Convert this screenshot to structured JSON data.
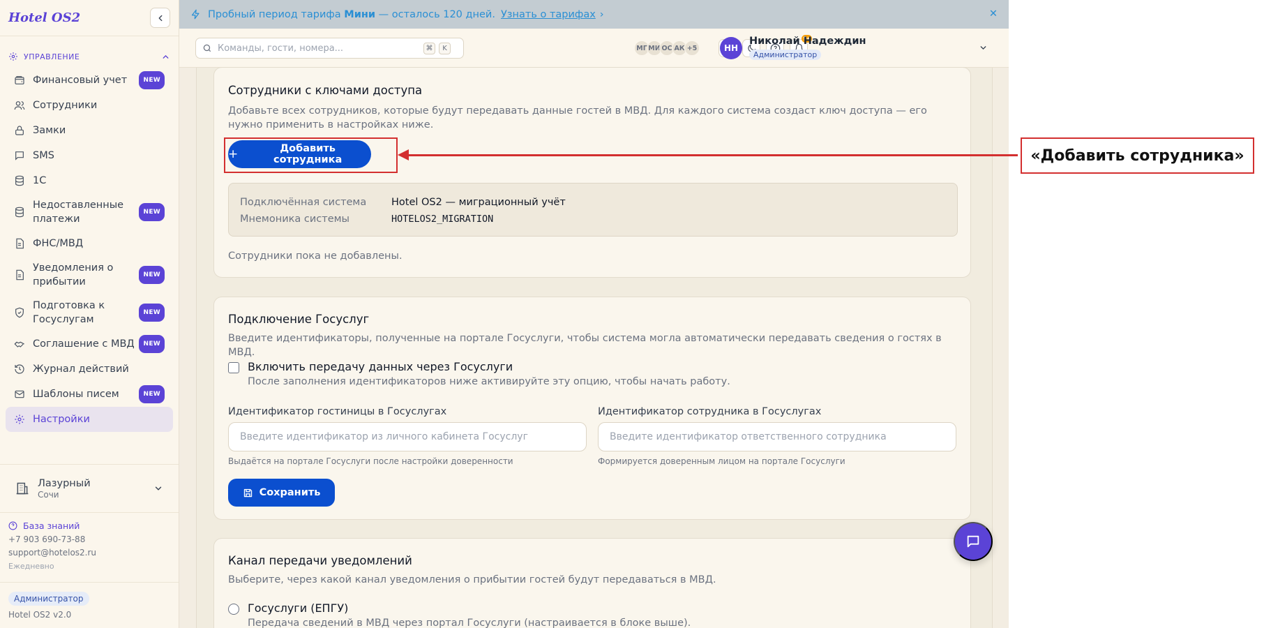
{
  "app": {
    "logo": "Hotel OS2",
    "version": "Hotel OS2 v2.0"
  },
  "colors": {
    "brand": "#5b43d6",
    "primary_button": "#0b4fcf",
    "callout": "#d32f2f",
    "notification_badge": "#f59e0b"
  },
  "sidebar": {
    "section_title": "УПРАВЛЕНИЕ",
    "items": [
      {
        "label": "Финансовый учет",
        "badge": "NEW",
        "icon": "wallet-icon"
      },
      {
        "label": "Сотрудники",
        "badge": "",
        "icon": "users-icon"
      },
      {
        "label": "Замки",
        "badge": "",
        "icon": "lock-icon"
      },
      {
        "label": "SMS",
        "badge": "",
        "icon": "message-icon"
      },
      {
        "label": "1С",
        "badge": "",
        "icon": "database-icon"
      },
      {
        "label": "Недоставленные платежи",
        "badge": "NEW",
        "icon": "database-icon"
      },
      {
        "label": "ФНС/МВД",
        "badge": "",
        "icon": "document-icon"
      },
      {
        "label": "Уведомления о прибытии",
        "badge": "NEW",
        "icon": "document-icon"
      },
      {
        "label": "Подготовка к Госуслугам",
        "badge": "NEW",
        "icon": "shield-check-icon"
      },
      {
        "label": "Соглашение с МВД",
        "badge": "NEW",
        "icon": "handshake-icon"
      },
      {
        "label": "Журнал действий",
        "badge": "",
        "icon": "history-icon"
      },
      {
        "label": "Шаблоны писем",
        "badge": "NEW",
        "icon": "mail-icon"
      },
      {
        "label": "Настройки",
        "badge": "",
        "icon": "gear-icon",
        "active": true
      }
    ],
    "hotel": {
      "name": "Лазурный",
      "city": "Сочи"
    },
    "help": {
      "knowledge_base": "База знаний",
      "phone": "+7 903 690-73-88",
      "email": "support@hotelos2.ru",
      "schedule": "Ежедневно"
    },
    "role": "Администратор"
  },
  "trial_banner": {
    "text_before": "Пробный период тарифа",
    "plan": "Мини",
    "text_after": "— осталось 120 дней.",
    "link": "Узнать о тарифах",
    "arrow": "›",
    "close": "✕"
  },
  "topbar": {
    "search_placeholder": "Команды, гости, номера...",
    "shortcut_keys": [
      "⌘",
      "K"
    ],
    "avatars": [
      "МГ",
      "МИ",
      "ОС",
      "АК",
      "+5"
    ],
    "notifications_count": "9+",
    "user": {
      "initials": "НН",
      "name": "Николай Надеждин",
      "role": "Администратор"
    }
  },
  "staff_card": {
    "title": "Сотрудники с ключами доступа",
    "description": "Добавьте всех сотрудников, которые будут передавать данные гостей в МВД. Для каждого система создаст ключ доступа — его нужно применить в настройках ниже.",
    "add_button": "Добавить сотрудника",
    "add_button_plus": "+",
    "system_rows": [
      {
        "key": "Подключённая система",
        "value": "Hotel OS2 — миграционный учёт",
        "mono": false
      },
      {
        "key": "Мнемоника системы",
        "value": "HOTELOS2_MIGRATION",
        "mono": true
      }
    ],
    "empty_text": "Сотрудники пока не добавлены."
  },
  "gosuslugi_card": {
    "title": "Подключение Госуслуг",
    "description": "Введите идентификаторы, полученные на портале Госуслуги, чтобы система могла автоматически передавать сведения о гостях в МВД.",
    "checkbox_label": "Включить передачу данных через Госуслуги",
    "checkbox_hint": "После заполнения идентификаторов ниже активируйте эту опцию, чтобы начать работу.",
    "checkbox_checked": false,
    "hotel_id": {
      "label": "Идентификатор гостиницы в Госуслугах",
      "placeholder": "Введите идентификатор из личного кабинета Госуслуг",
      "value": "",
      "hint": "Выдаётся на портале Госуслуги после настройки доверенности"
    },
    "employee_id": {
      "label": "Идентификатор сотрудника в Госуслугах",
      "placeholder": "Введите идентификатор ответственного сотрудника",
      "value": "",
      "hint": "Формируется доверенным лицом на портале Госуслуги"
    },
    "save_button": "Сохранить"
  },
  "channel_card": {
    "title": "Канал передачи уведомлений",
    "description": "Выберите, через какой канал уведомления о прибытии гостей будут передаваться в МВД.",
    "option_label": "Госуслуги (ЕПГУ)",
    "option_hint": "Передача сведений в МВД через портал Госуслуги (настраивается в блоке выше).",
    "option_selected": false
  },
  "annotation": {
    "label": "«Добавить сотрудника»"
  }
}
